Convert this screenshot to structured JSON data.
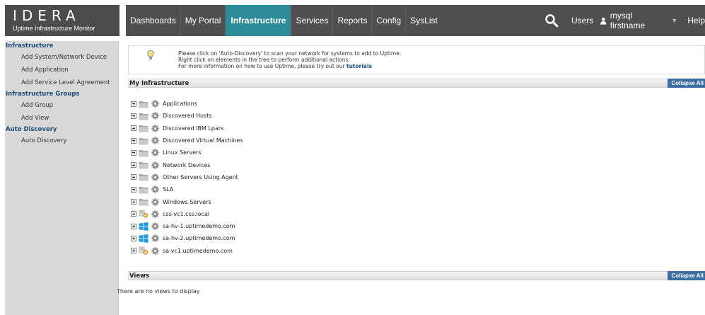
{
  "logo": {
    "brand": "IDERA",
    "product": "Uptime Infrastructure Monitor"
  },
  "nav": {
    "tabs": [
      "Dashboards",
      "My Portal",
      "Infrastructure",
      "Services",
      "Reports",
      "Config",
      "SysList"
    ],
    "active_tab": "Infrastructure",
    "users_label": "Users",
    "user_name": "mysql firstname",
    "help_label": "Help"
  },
  "sidebar": {
    "sections": [
      {
        "title": "Infrastructure",
        "items": [
          "Add System/Network Device",
          "Add Application",
          "Add Service Level Agreement"
        ]
      },
      {
        "title": "Infrastructure Groups",
        "items": [
          "Add Group",
          "Add View"
        ]
      },
      {
        "title": "Auto Discovery",
        "items": [
          "Auto Discovery"
        ]
      }
    ]
  },
  "tip": {
    "line1": "Please click on 'Auto-Discovery' to scan your network for systems to add to Uptime.",
    "line2": "Right click on elements in the tree to perform additional actions.",
    "line3_prefix": "For more information on how to use Uptime, please try out our",
    "line3_link": "tutorials"
  },
  "infrastructure": {
    "title": "My Infrastructure",
    "collapse_label": "Collapse All",
    "nodes": [
      {
        "label": "Applications",
        "icon": "folder-icon"
      },
      {
        "label": "Discovered Hosts",
        "icon": "folder-icon"
      },
      {
        "label": "Discovered IBM Lpars",
        "icon": "folder-icon"
      },
      {
        "label": "Discovered Virtual Machines",
        "icon": "folder-icon"
      },
      {
        "label": "Linux Servers",
        "icon": "folder-icon"
      },
      {
        "label": "Network Devices",
        "icon": "folder-icon"
      },
      {
        "label": "Other Servers Using Agent",
        "icon": "folder-icon"
      },
      {
        "label": "SLA",
        "icon": "folder-icon"
      },
      {
        "label": "Windows Servers",
        "icon": "folder-icon"
      },
      {
        "label": "css-vc1.css.local",
        "icon": "vcenter-icon"
      },
      {
        "label": "sa-hv-1.uptimedemo.com",
        "icon": "windows-icon"
      },
      {
        "label": "sa-hv-2.uptimedemo.com",
        "icon": "windows-icon"
      },
      {
        "label": "sa-vc1.uptimedemo.com",
        "icon": "vcenter-icon"
      }
    ]
  },
  "views": {
    "title": "Views",
    "collapse_label": "Collapse All",
    "empty_text": "There are no views to display"
  },
  "colors": {
    "nav_bg": "#4f4f4f",
    "active_tab": "#2e8b9a",
    "sidebar_bg": "#d9d9d9",
    "section_link": "#1e4d7a",
    "collapse_btn": "#3c6ea2"
  }
}
